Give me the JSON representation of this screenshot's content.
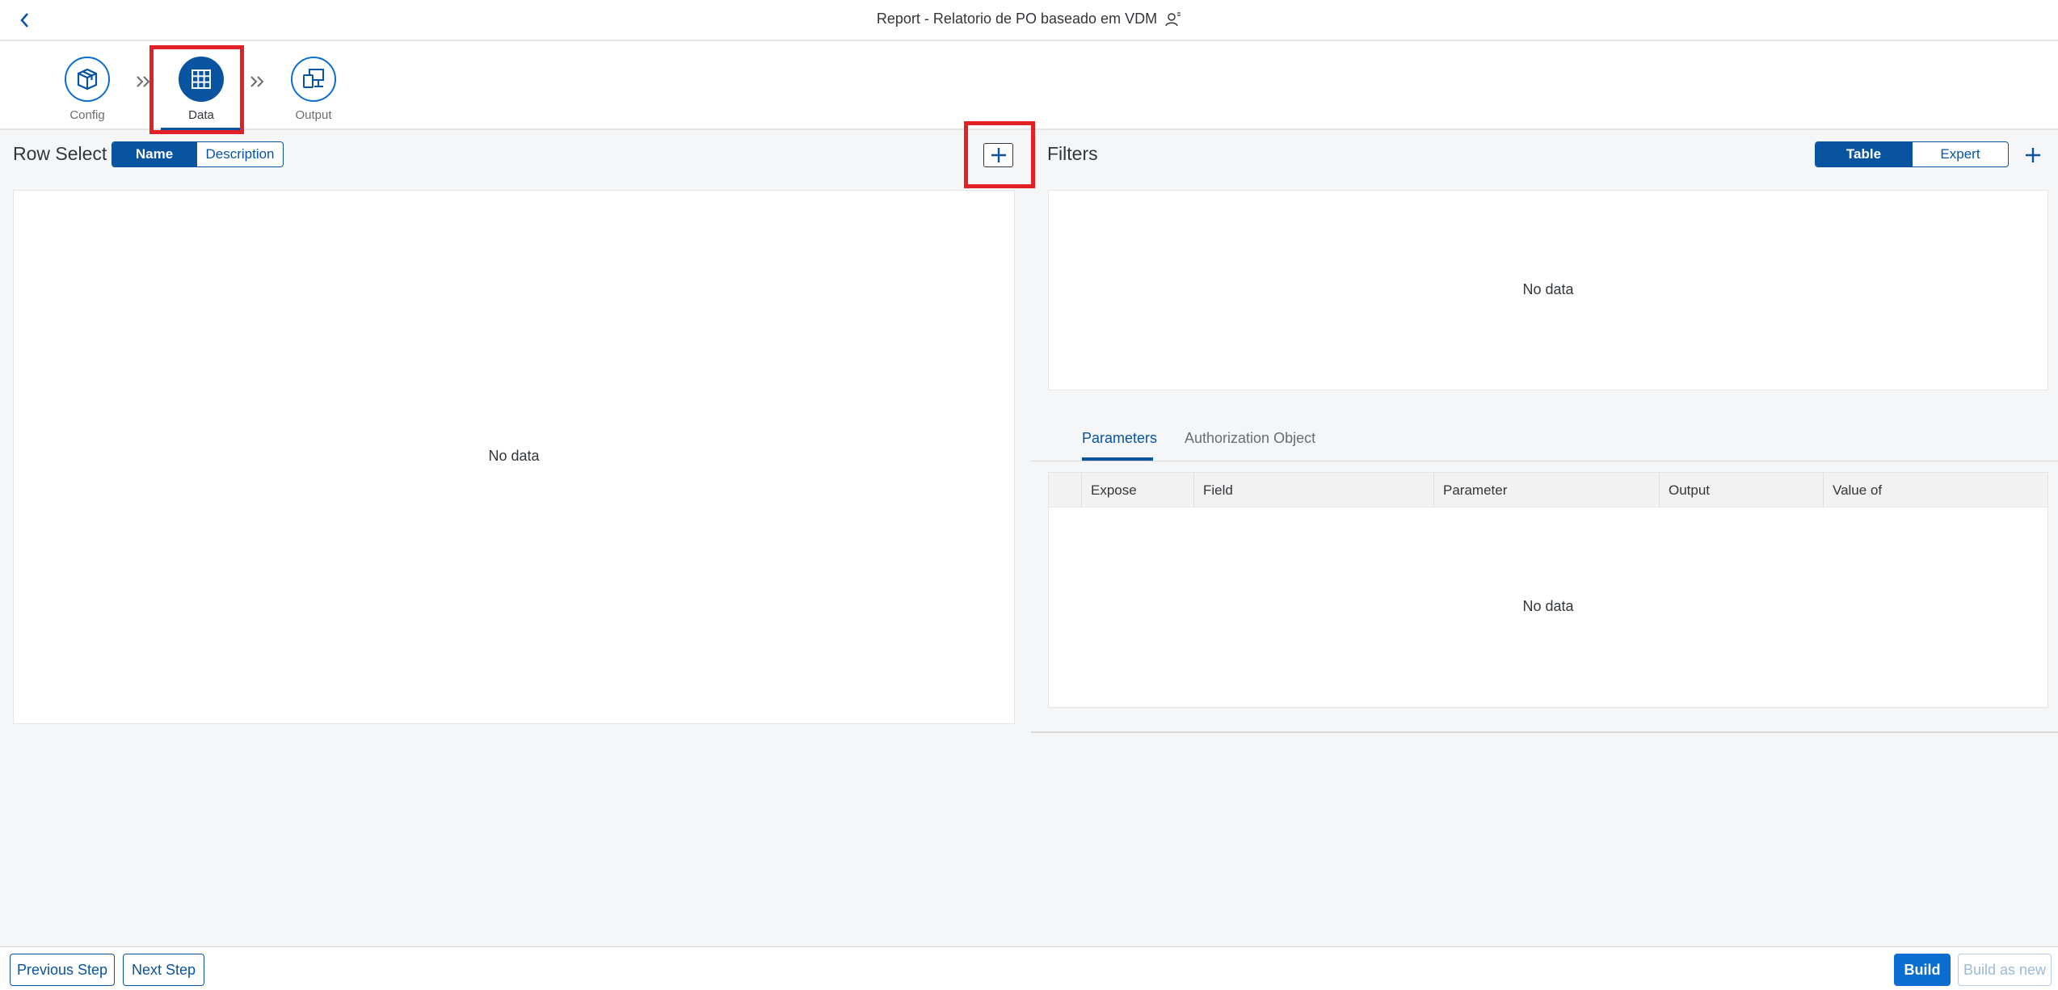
{
  "header": {
    "title": "Report - Relatorio de PO baseado em VDM",
    "back_icon": "chevron-left-icon",
    "user_icon": "user-settings-icon"
  },
  "wizard": {
    "steps": [
      {
        "label": "Config",
        "icon": "package-icon",
        "active": false
      },
      {
        "label": "Data",
        "icon": "grid-icon",
        "active": true
      },
      {
        "label": "Output",
        "icon": "devices-icon",
        "active": false
      }
    ],
    "separator_icon": "double-chevron-right-icon"
  },
  "row_select": {
    "title": "Row Select",
    "toggle": {
      "options": [
        "Name",
        "Description"
      ],
      "selected": "Name"
    },
    "empty_text": "No data",
    "add_icon": "add-icon"
  },
  "filters": {
    "title": "Filters",
    "toggle": {
      "options": [
        "Table",
        "Expert"
      ],
      "selected": "Table"
    },
    "empty_text": "No data",
    "add_icon": "add-icon"
  },
  "tabs": [
    {
      "label": "Parameters",
      "active": true
    },
    {
      "label": "Authorization Object",
      "active": false
    }
  ],
  "parameters_table": {
    "columns": [
      "Expose",
      "Field",
      "Parameter",
      "Output",
      "Value of"
    ],
    "empty_text": "No data"
  },
  "footer": {
    "previous_label": "Previous Step",
    "next_label": "Next Step",
    "build_label": "Build",
    "build_new_label": "Build as new"
  },
  "colors": {
    "brand": "#0854a0",
    "emphasized": "#0a6ed1",
    "highlight": "#e32026",
    "background": "#f5f6f7"
  }
}
